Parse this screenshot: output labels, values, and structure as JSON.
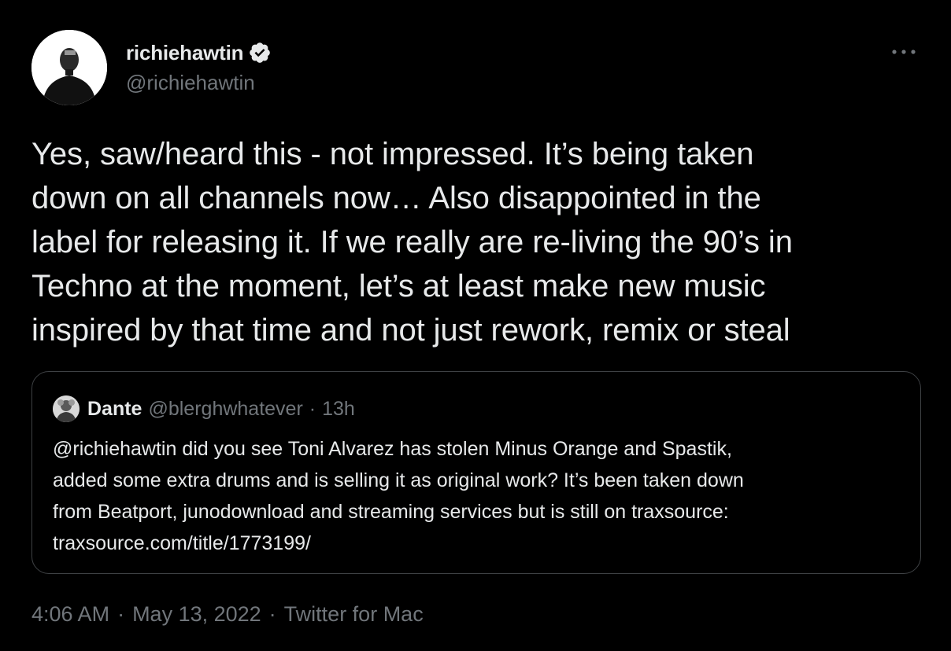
{
  "author": {
    "display_name": "richiehawtin",
    "handle": "@richiehawtin",
    "verified": true,
    "avatar_icon": "profile-photo-avatar"
  },
  "tweet": {
    "lines": [
      "Yes, saw/heard this - not impressed. It’s being taken",
      "down on all channels now… Also disappointed in the",
      "label for releasing it. If we really are re-living the 90’s in",
      "Techno at the moment, let’s at least make new music",
      "inspired by that time and not just rework, remix or steal"
    ]
  },
  "quoted_tweet": {
    "display_name": "Dante",
    "handle": "@blerghwhatever",
    "separator": "·",
    "time": "13h",
    "lines": [
      "@richiehawtin did you see Toni Alvarez has stolen Minus Orange and Spastik,",
      "added some extra drums and is selling it as original work? It’s been taken down",
      "from Beatport, junodownload and streaming services but is still on traxsource:",
      "traxsource.com/title/1773199/"
    ]
  },
  "meta": {
    "time": "4:06 AM",
    "separator": "·",
    "date": "May 13, 2022",
    "source": "Twitter for Mac"
  },
  "colors": {
    "background": "#000000",
    "text_primary": "#e7e9ea",
    "text_secondary": "#71767b",
    "border": "#3e4144",
    "verified_badge": "#e7e9ea"
  },
  "icons": {
    "more": "more-horizontal-icon",
    "verified": "verified-badge-icon"
  }
}
